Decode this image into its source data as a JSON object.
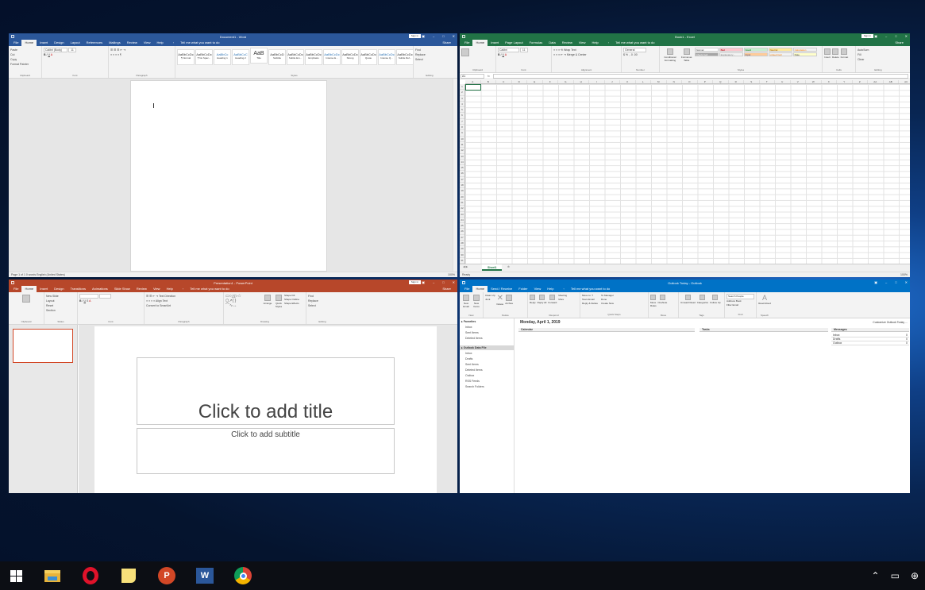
{
  "word": {
    "title": "Document1 - Word",
    "sign_in": "Sign in",
    "tabs": [
      "File",
      "Home",
      "Insert",
      "Design",
      "Layout",
      "References",
      "Mailings",
      "Review",
      "View",
      "Help"
    ],
    "tell": "Tell me what you want to do",
    "share": "Share",
    "clip": {
      "paste": "Paste",
      "cut": "Cut",
      "copy": "Copy",
      "painter": "Format Painter",
      "label": "Clipboard"
    },
    "font": {
      "name": "Calibri (Body)",
      "size": "11",
      "label": "Font"
    },
    "paragraph_label": "Paragraph",
    "styles": [
      {
        "sample": "AaBbCcDc",
        "name": "¶ Normal"
      },
      {
        "sample": "AaBbCcDc",
        "name": "¶ No Spac..."
      },
      {
        "sample": "AaBbCc",
        "name": "Heading 1"
      },
      {
        "sample": "AaBbCcC",
        "name": "Heading 2"
      },
      {
        "sample": "AaB",
        "name": "Title"
      },
      {
        "sample": "AaBbCcD",
        "name": "Subtitle"
      },
      {
        "sample": "AaBbCcDc",
        "name": "Subtle Em..."
      },
      {
        "sample": "AaBbCcDc",
        "name": "Emphasis"
      },
      {
        "sample": "AaBbCcDc",
        "name": "Intense E..."
      },
      {
        "sample": "AaBbCcDc",
        "name": "Strong"
      },
      {
        "sample": "AaBbCcDc",
        "name": "Quote"
      },
      {
        "sample": "AaBbCcDc",
        "name": "Intense Q..."
      },
      {
        "sample": "AaBbCcDc",
        "name": "Subtle Ref..."
      }
    ],
    "styles_label": "Styles",
    "editing": {
      "find": "Find",
      "replace": "Replace",
      "select": "Select",
      "label": "Editing"
    },
    "status": "Page 1 of 1   0 words   English (United States)",
    "zoom": "100%"
  },
  "excel": {
    "title": "Book1 - Excel",
    "sign_in": "Sign in",
    "tabs": [
      "File",
      "Home",
      "Insert",
      "Page Layout",
      "Formulas",
      "Data",
      "Review",
      "View",
      "Help"
    ],
    "tell": "Tell me what you want to do",
    "share": "Share",
    "font_name": "Calibri",
    "font_size": "11",
    "wrap": "Wrap Text",
    "merge": "Merge & Center",
    "number_format": "General",
    "cond": "Conditional Formatting",
    "fmt_table": "Format as Table",
    "cell_styles": [
      {
        "name": "Normal",
        "bg": "#ffffff",
        "fg": "#000000"
      },
      {
        "name": "Bad",
        "bg": "#ffc7ce",
        "fg": "#9c0006"
      },
      {
        "name": "Good",
        "bg": "#c6efce",
        "fg": "#006100"
      },
      {
        "name": "Neutral",
        "bg": "#ffeb9c",
        "fg": "#9c5700"
      },
      {
        "name": "Calculation",
        "bg": "#f2f2f2",
        "fg": "#fa7d00"
      },
      {
        "name": "Check Cell",
        "bg": "#a5a5a5",
        "fg": "#ffffff"
      },
      {
        "name": "Explanatory...",
        "bg": "#ffffff",
        "fg": "#7f7f7f"
      },
      {
        "name": "Input",
        "bg": "#ffcc99",
        "fg": "#3f3f76"
      },
      {
        "name": "Linked Cell",
        "bg": "#ffffff",
        "fg": "#fa7d00"
      },
      {
        "name": "Note",
        "bg": "#ffffcc",
        "fg": "#000000"
      }
    ],
    "cells_grp": {
      "insert": "Insert",
      "delete": "Delete",
      "format": "Format"
    },
    "editing": {
      "autosum": "AutoSum",
      "fill": "Fill",
      "clear": "Clear",
      "sort": "Sort & Filter",
      "find": "Find & Select"
    },
    "groups": [
      "Clipboard",
      "Font",
      "Alignment",
      "Number",
      "Styles",
      "Cells",
      "Editing"
    ],
    "name_box": "A1",
    "fx": "fx",
    "columns": [
      "A",
      "B",
      "C",
      "D",
      "E",
      "F",
      "G",
      "H",
      "I",
      "J",
      "K",
      "L",
      "M",
      "N",
      "O",
      "P",
      "Q",
      "R",
      "S",
      "T",
      "U",
      "V",
      "W",
      "X",
      "Y",
      "Z",
      "AA",
      "AB",
      "AC"
    ],
    "rows": [
      "1",
      "2",
      "3",
      "4",
      "5",
      "6",
      "7",
      "8",
      "9",
      "10",
      "11",
      "12",
      "13",
      "14",
      "15",
      "16",
      "17",
      "18",
      "19",
      "20",
      "21",
      "22",
      "23",
      "24",
      "25",
      "26",
      "27",
      "28",
      "29",
      "30",
      "31",
      "32",
      "33",
      "34",
      "35",
      "36"
    ],
    "sheet": "Sheet1",
    "status": "Ready",
    "zoom": "100%"
  },
  "ppt": {
    "title": "Presentation1 - PowerPoint",
    "sign_in": "Sign in",
    "tabs": [
      "File",
      "Home",
      "Insert",
      "Design",
      "Transitions",
      "Animations",
      "Slide Show",
      "Review",
      "View",
      "Help"
    ],
    "tell": "Tell me what you want to do",
    "share": "Share",
    "slides_grp": {
      "new": "New Slide",
      "layout": "Layout",
      "reset": "Reset",
      "section": "Section",
      "label": "Slides"
    },
    "groups": [
      "Clipboard",
      "Slides",
      "Font",
      "Paragraph",
      "Drawing",
      "Editing"
    ],
    "text_direction": "Text Direction",
    "align_text": "Align Text",
    "convert": "Convert to SmartArt",
    "arrange": "Arrange",
    "quick": "Quick Styles",
    "shape_fill": "Shape Fill",
    "shape_outline": "Shape Outline",
    "shape_effects": "Shape Effects",
    "find": "Find",
    "replace": "Replace",
    "select": "Select",
    "slide_title": "Click to add title",
    "slide_subtitle": "Click to add subtitle"
  },
  "outlook": {
    "title": "Outlook Today - Outlook",
    "tabs": [
      "File",
      "Home",
      "Send / Receive",
      "Folder",
      "View",
      "Help"
    ],
    "tell": "Tell me what you want to do",
    "groups": [
      "New",
      "Delete",
      "Respond",
      "Quick Steps",
      "Move",
      "Tags",
      "Find",
      "Speech"
    ],
    "ribbon": {
      "new_email": "New Email",
      "new_items": "New Items",
      "clean": "Clean Up",
      "junk": "Junk",
      "delete": "Delete",
      "archive": "Archive",
      "reply": "Reply",
      "reply_all": "Reply All",
      "forward": "Forward",
      "meeting": "Meeting",
      "more": "More",
      "move_to": "Move to: ?",
      "to_manager": "To Manager",
      "team_email": "Team Email",
      "done": "Done",
      "reply_delete": "Reply & Delete",
      "create_new": "Create New",
      "move": "Move",
      "rules": "Rules",
      "onenote": "OneNote",
      "unread": "Unread/ Read",
      "categorize": "Categorize",
      "follow": "Follow Up",
      "search_people": "Search People",
      "address_book": "Address Book",
      "filter_email": "Filter Email",
      "read_aloud": "Read Aloud"
    },
    "favorites_header": "Favorites",
    "favorites": [
      "Inbox",
      "Sent Items",
      "Deleted Items"
    ],
    "data_file_header": "Outlook Data File",
    "folders": [
      "Inbox",
      "Drafts",
      "Sent Items",
      "Deleted Items",
      "Outbox",
      "RSS Feeds",
      "Search Folders"
    ],
    "date": "Monday, April 1, 2019",
    "customize": "Customize Outlook Today ...",
    "calendar": "Calendar",
    "tasks": "Tasks",
    "messages_header": "Messages",
    "messages": [
      {
        "name": "Inbox",
        "count": "0"
      },
      {
        "name": "Drafts",
        "count": "0"
      },
      {
        "name": "Outbox",
        "count": "0"
      }
    ]
  },
  "taskbar": {
    "icons": [
      "windows-start",
      "file-explorer",
      "opera",
      "sticky-notes",
      "powerpoint",
      "word",
      "chrome"
    ],
    "tray_time_hidden": ""
  }
}
